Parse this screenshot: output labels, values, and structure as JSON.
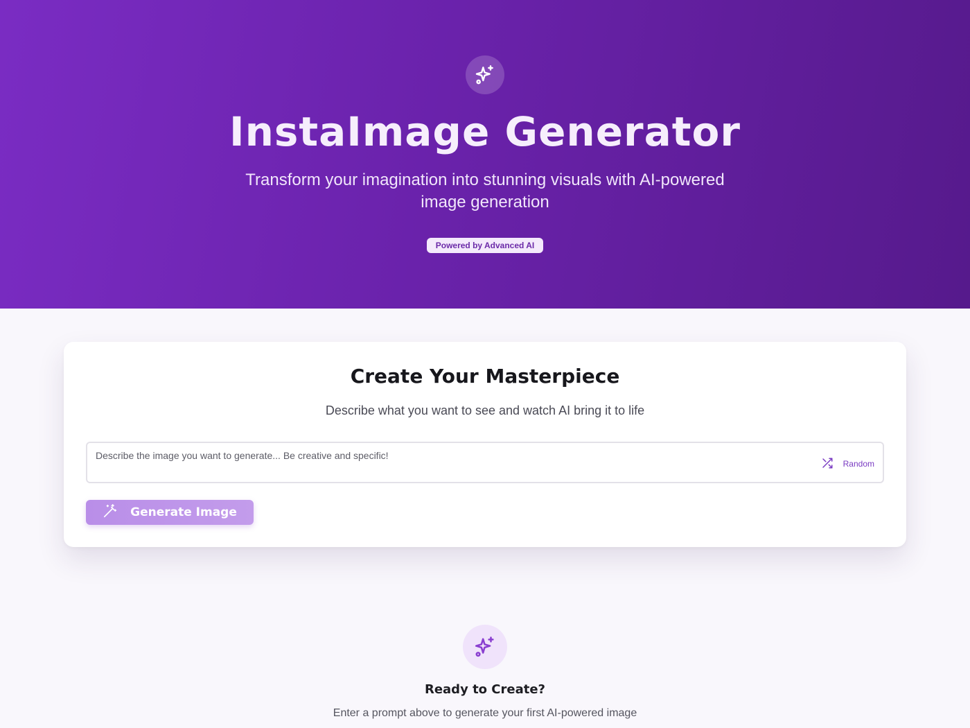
{
  "hero": {
    "icon": "sparkles-icon",
    "title": "InstaImage Generator",
    "subtitle": "Transform your imagination into stunning visuals with AI-powered image generation",
    "badge": "Powered by Advanced AI"
  },
  "card": {
    "title": "Create Your Masterpiece",
    "subtitle": "Describe what you want to see and watch AI bring it to life",
    "prompt": {
      "value": "",
      "placeholder": "Describe the image you want to generate... Be creative and specific!"
    },
    "random_label": "Random",
    "random_icon": "shuffle-icon",
    "generate_label": "Generate Image",
    "generate_icon": "magic-wand-icon"
  },
  "empty_state": {
    "icon": "sparkles-icon",
    "title": "Ready to Create?",
    "subtitle": "Enter a prompt above to generate your first AI-powered image"
  },
  "colors": {
    "hero_gradient_start": "#7a2cc3",
    "hero_gradient_end": "#561a8c",
    "accent": "#7a3bc2",
    "button": "#b98ee8"
  }
}
